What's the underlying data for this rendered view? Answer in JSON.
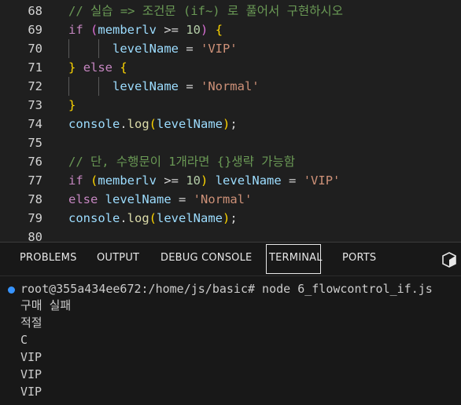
{
  "editor": {
    "lines": [
      {
        "num": "68",
        "tokens": [
          {
            "t": "// 실습 => 조건문 (if~) 로 풀어서 구현하시오",
            "c": "comment"
          }
        ]
      },
      {
        "num": "69",
        "tokens": [
          {
            "t": "if",
            "c": "kw"
          },
          {
            "t": " ",
            "c": "op"
          },
          {
            "t": "(",
            "c": "b2"
          },
          {
            "t": "memberlv",
            "c": "var"
          },
          {
            "t": " >= ",
            "c": "op"
          },
          {
            "t": "10",
            "c": "num"
          },
          {
            "t": ")",
            "c": "b2"
          },
          {
            "t": " ",
            "c": "op"
          },
          {
            "t": "{",
            "c": "b1"
          }
        ]
      },
      {
        "num": "70",
        "tokens": [
          {
            "t": "      levelName",
            "c": "var"
          },
          {
            "t": " = ",
            "c": "op"
          },
          {
            "t": "'VIP'",
            "c": "str"
          }
        ]
      },
      {
        "num": "71",
        "tokens": [
          {
            "t": "}",
            "c": "b1"
          },
          {
            "t": " ",
            "c": "op"
          },
          {
            "t": "else",
            "c": "kw"
          },
          {
            "t": " ",
            "c": "op"
          },
          {
            "t": "{",
            "c": "b1"
          }
        ]
      },
      {
        "num": "72",
        "tokens": [
          {
            "t": "      levelName",
            "c": "var"
          },
          {
            "t": " = ",
            "c": "op"
          },
          {
            "t": "'Normal'",
            "c": "str"
          }
        ]
      },
      {
        "num": "73",
        "tokens": [
          {
            "t": "}",
            "c": "b1"
          }
        ]
      },
      {
        "num": "74",
        "tokens": [
          {
            "t": "console",
            "c": "var"
          },
          {
            "t": ".",
            "c": "op"
          },
          {
            "t": "log",
            "c": "fn"
          },
          {
            "t": "(",
            "c": "b1"
          },
          {
            "t": "levelName",
            "c": "var"
          },
          {
            "t": ")",
            "c": "b1"
          },
          {
            "t": ";",
            "c": "op"
          }
        ]
      },
      {
        "num": "75",
        "tokens": []
      },
      {
        "num": "76",
        "tokens": [
          {
            "t": "// 단, 수행문이 1개라면 {}생략 가능함",
            "c": "comment"
          }
        ]
      },
      {
        "num": "77",
        "tokens": [
          {
            "t": "if",
            "c": "kw"
          },
          {
            "t": " ",
            "c": "op"
          },
          {
            "t": "(",
            "c": "b1"
          },
          {
            "t": "memberlv",
            "c": "var"
          },
          {
            "t": " >= ",
            "c": "op"
          },
          {
            "t": "10",
            "c": "num"
          },
          {
            "t": ")",
            "c": "b1"
          },
          {
            "t": " ",
            "c": "op"
          },
          {
            "t": "levelName",
            "c": "var"
          },
          {
            "t": " = ",
            "c": "op"
          },
          {
            "t": "'VIP'",
            "c": "str"
          }
        ]
      },
      {
        "num": "78",
        "tokens": [
          {
            "t": "else",
            "c": "kw"
          },
          {
            "t": " ",
            "c": "op"
          },
          {
            "t": "levelName",
            "c": "var"
          },
          {
            "t": " = ",
            "c": "op"
          },
          {
            "t": "'Normal'",
            "c": "str"
          }
        ]
      },
      {
        "num": "79",
        "tokens": [
          {
            "t": "console",
            "c": "var"
          },
          {
            "t": ".",
            "c": "op"
          },
          {
            "t": "log",
            "c": "fn"
          },
          {
            "t": "(",
            "c": "b1"
          },
          {
            "t": "levelName",
            "c": "var"
          },
          {
            "t": ")",
            "c": "b1"
          },
          {
            "t": ";",
            "c": "op"
          }
        ]
      },
      {
        "num": "80",
        "tokens": []
      }
    ]
  },
  "panel": {
    "tabs": {
      "problems": "PROBLEMS",
      "output": "OUTPUT",
      "debug_console": "DEBUG CONSOLE",
      "terminal": "TERMINAL",
      "ports": "PORTS"
    },
    "active_tab": "terminal",
    "new_terminal_icon": "terminal-split-icon"
  },
  "terminal": {
    "command_line": "root@355a434ee672:/home/js/basic# node 6_flowcontrol_if.js",
    "output": [
      "구매 실패",
      "적절",
      "C",
      "VIP",
      "VIP",
      "VIP"
    ]
  },
  "colors": {
    "editor_bg": "#1f1f1f",
    "panel_bg": "#181818",
    "comment": "#6a9955",
    "keyword": "#c586c0",
    "variable": "#9cdcfe",
    "string": "#ce9178",
    "number": "#b5cea8",
    "bracket_gold": "#ffd700",
    "bracket_purple": "#da70d6",
    "function": "#dcdcaa",
    "status_dot": "#3794ff"
  }
}
